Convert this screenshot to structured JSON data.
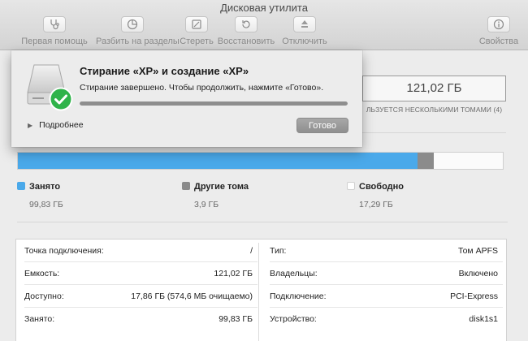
{
  "window": {
    "title": "Дисковая утилита"
  },
  "toolbar": {
    "items": [
      {
        "label": "Первая помощь",
        "icon": "stethoscope-icon"
      },
      {
        "label": "Разбить на разделы",
        "icon": "pie-chart-icon"
      },
      {
        "label": "Стереть",
        "icon": "eraser-icon"
      },
      {
        "label": "Восстановить",
        "icon": "restore-icon"
      },
      {
        "label": "Отключить",
        "icon": "eject-icon"
      },
      {
        "label": "Свойства",
        "icon": "info-icon"
      }
    ]
  },
  "capacity": {
    "value": "121,02 ГБ",
    "subtitle": "ЛЬЗУЕТСЯ НЕСКОЛЬКИМИ ТОМАМИ (4)"
  },
  "usage": {
    "fractions": {
      "used": 0.8249,
      "other": 0.0322,
      "free": 0.1429
    },
    "legend": [
      {
        "name": "Занято",
        "value": "99,83 ГБ",
        "color": "#4aa9ea"
      },
      {
        "name": "Другие тома",
        "value": "3,9 ГБ",
        "color": "#8b8b8b"
      },
      {
        "name": "Свободно",
        "value": "17,29 ГБ",
        "color": "#ffffff"
      }
    ]
  },
  "info": {
    "left": [
      {
        "key": "Точка подключения:",
        "value": "/"
      },
      {
        "key": "Емкость:",
        "value": "121,02 ГБ"
      },
      {
        "key": "Доступно:",
        "value": "17,86 ГБ (574,6 МБ очищаемо)"
      },
      {
        "key": "Занято:",
        "value": "99,83 ГБ"
      }
    ],
    "right": [
      {
        "key": "Тип:",
        "value": "Том APFS"
      },
      {
        "key": "Владельцы:",
        "value": "Включено"
      },
      {
        "key": "Подключение:",
        "value": "PCI-Express"
      },
      {
        "key": "Устройство:",
        "value": "disk1s1"
      }
    ]
  },
  "sheet": {
    "title": "Стирание «XP» и создание «XP»",
    "message": "Стирание завершено. Чтобы продолжить, нажмите «Готово».",
    "progress": 1.0,
    "details_label": "Подробнее",
    "done_label": "Готово",
    "accent": "#2fb34a"
  }
}
